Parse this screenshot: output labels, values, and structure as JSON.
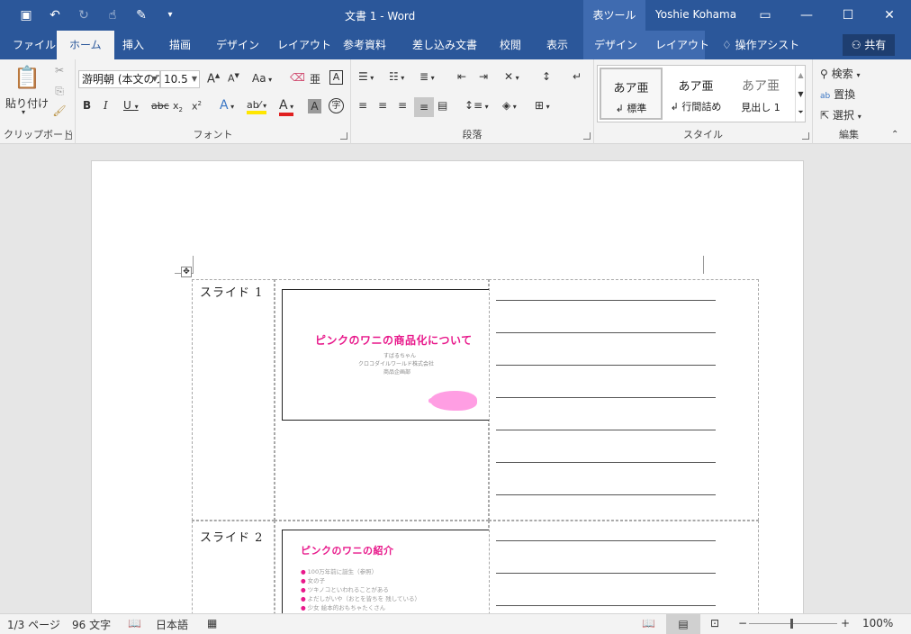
{
  "titlebar": {
    "doc_title": "文書 1 - Word",
    "context_tools": "表ツール",
    "user": "Yoshie Kohama"
  },
  "tabs": {
    "file": "ファイル",
    "home": "ホーム",
    "insert": "挿入",
    "draw": "描画",
    "design": "デザイン",
    "layout": "レイアウト",
    "references": "参考資料",
    "mailings": "差し込み文書",
    "review": "校閲",
    "view": "表示",
    "table_design": "デザイン",
    "table_layout": "レイアウト",
    "tell_me": "操作アシスト",
    "share": "共有"
  },
  "ribbon": {
    "clipboard": {
      "paste": "貼り付け",
      "label": "クリップボード"
    },
    "font": {
      "name": "游明朝 (本文のフォント",
      "size": "10.5",
      "aa_label": "Aa",
      "label": "フォント"
    },
    "paragraph": {
      "label": "段落"
    },
    "styles": {
      "label": "スタイル",
      "items": [
        {
          "sample": "あア亜",
          "name": "標準"
        },
        {
          "sample": "あア亜",
          "name": "行間詰め"
        },
        {
          "sample": "あア亜",
          "name": "見出し 1"
        }
      ]
    },
    "editing": {
      "find": "検索",
      "replace": "置換",
      "select": "選択",
      "label": "編集"
    }
  },
  "document": {
    "slides": [
      {
        "label": "スライド 1",
        "title": "ピンクのワニの商品化について",
        "subtitle_lines": [
          "すばるちゃん",
          "クロコダイルワールド株式会社",
          "商品企画部"
        ]
      },
      {
        "label": "スライド 2",
        "title": "ピンクのワニの紹介",
        "bullets": [
          "100万年前に誕生（参照）",
          "女の子",
          "ツキノコといわれることがある",
          "よだしがいや（おとを皆ちを 残している）",
          "少女 絵本的おもちゃたくさん"
        ]
      }
    ]
  },
  "status": {
    "page": "1/3 ページ",
    "words": "96 文字",
    "language": "日本語",
    "zoom": "100%"
  }
}
